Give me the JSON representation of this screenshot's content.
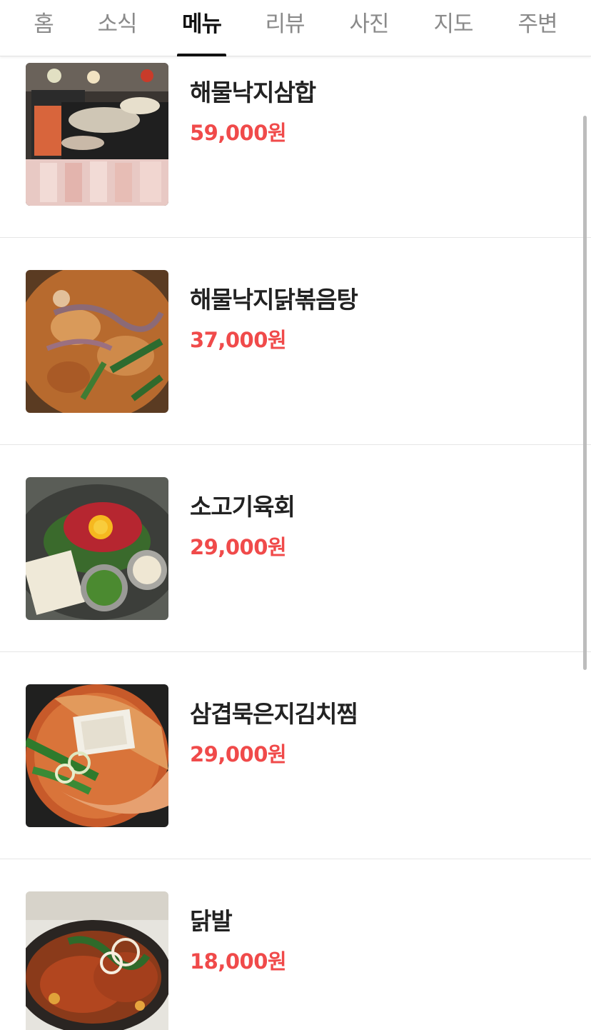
{
  "tabs": [
    {
      "label": "홈",
      "active": false
    },
    {
      "label": "소식",
      "active": false
    },
    {
      "label": "메뉴",
      "active": true
    },
    {
      "label": "리뷰",
      "active": false
    },
    {
      "label": "사진",
      "active": false
    },
    {
      "label": "지도",
      "active": false
    },
    {
      "label": "주변",
      "active": false
    }
  ],
  "menu": [
    {
      "name": "해물낙지삼합",
      "price": "59,000원"
    },
    {
      "name": "해물낙지닭볶음탕",
      "price": "37,000원"
    },
    {
      "name": "소고기육회",
      "price": "29,000원"
    },
    {
      "name": "삼겹묵은지김치찜",
      "price": "29,000원"
    },
    {
      "name": "닭발",
      "price": "18,000원"
    }
  ],
  "colors": {
    "price": "#f04a4a",
    "active_tab": "#111111",
    "inactive_tab": "#8a8a8a"
  }
}
